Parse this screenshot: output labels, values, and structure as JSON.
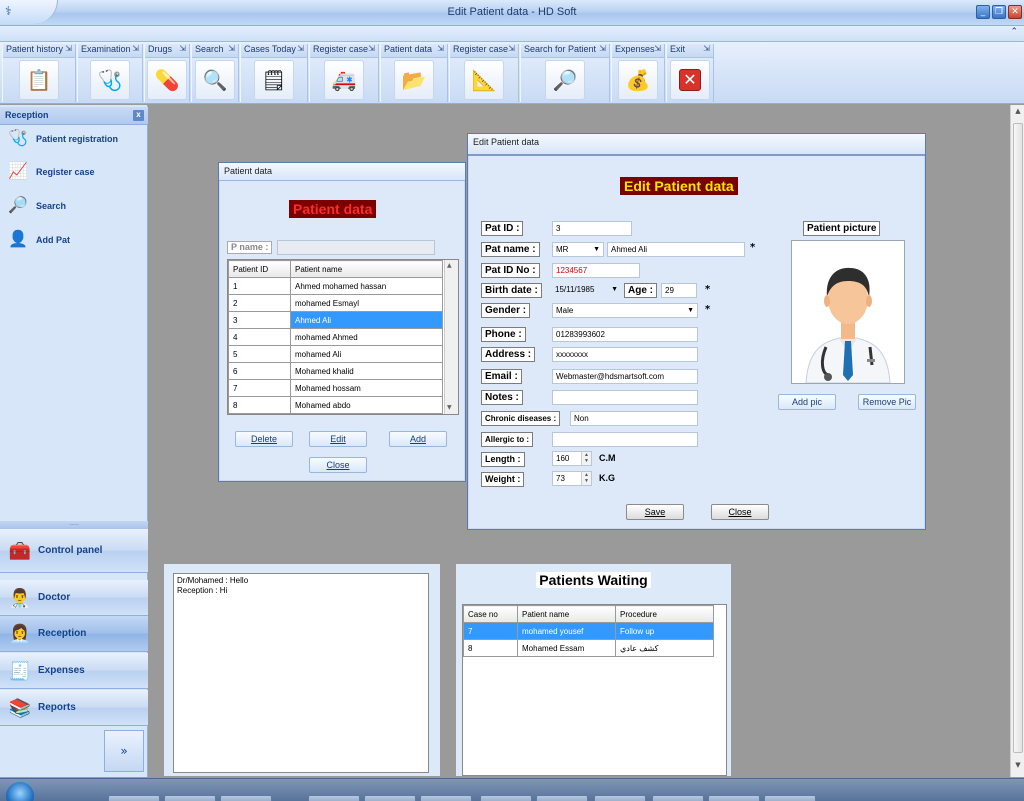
{
  "window": {
    "title": "Edit Patient data - HD Soft"
  },
  "toolbar": {
    "groups": [
      {
        "label": "Patient history",
        "icon": "patient-history-icon"
      },
      {
        "label": "Examination",
        "icon": "stethoscope-icon"
      },
      {
        "label": "Drugs",
        "icon": "pills-icon"
      },
      {
        "label": "Search",
        "icon": "magnifier-icon"
      },
      {
        "label": "Cases Today",
        "icon": "cases-icon"
      },
      {
        "label": "Register case",
        "icon": "register-case-icon"
      },
      {
        "label": "Patient  data",
        "icon": "folder-icon"
      },
      {
        "label": "Register case",
        "icon": "register-case-2-icon"
      },
      {
        "label": "Search for  Patient",
        "icon": "search-patient-icon"
      },
      {
        "label": "Expenses",
        "icon": "money-bag-icon"
      },
      {
        "label": "Exit",
        "icon": "exit-icon"
      }
    ]
  },
  "leftnav": {
    "header": "Reception",
    "items": [
      {
        "label": "Patient registration",
        "icon": "stethoscope-icon"
      },
      {
        "label": "Register case",
        "icon": "chart-icon"
      },
      {
        "label": "Search",
        "icon": "search-icon"
      },
      {
        "label": "Add Pat",
        "icon": "add-user-icon"
      }
    ],
    "bars": [
      {
        "label": "Control panel",
        "icon": "control-panel-icon"
      },
      {
        "label": "Doctor",
        "icon": "doctor-icon"
      },
      {
        "label": "Reception",
        "icon": "reception-icon"
      },
      {
        "label": "Expenses",
        "icon": "expenses-icon"
      },
      {
        "label": "Reports",
        "icon": "reports-icon"
      }
    ]
  },
  "patient_list": {
    "caption": "Patient  data",
    "title": "Patient  data",
    "pname_label": "P name :",
    "columns": [
      "Patient ID",
      "Patient  name"
    ],
    "rows": [
      [
        "1",
        "Ahmed mohamed hassan"
      ],
      [
        "2",
        "mohamed Esmayl"
      ],
      [
        "3",
        "Ahmed Ali"
      ],
      [
        "4",
        "mohamed Ahmed"
      ],
      [
        "5",
        "mohamed Ali"
      ],
      [
        "6",
        "Mohamed khalid"
      ],
      [
        "7",
        "Mohamed hossam"
      ],
      [
        "8",
        "Mohamed abdo"
      ]
    ],
    "selected_row": 2,
    "buttons": {
      "delete": "Delete",
      "edit": "Edit",
      "add": "Add",
      "close": "Close"
    }
  },
  "edit_form": {
    "caption": "Edit Patient data",
    "title": "Edit Patient data",
    "labels": {
      "pat_id": "Pat ID :",
      "pat_name": "Pat name :",
      "pat_id_no": "Pat ID No :",
      "birth_date": "Birth date :",
      "age": "Age :",
      "gender": "Gender :",
      "phone": "Phone :",
      "address": "Address :",
      "email": "Email :",
      "notes": "Notes :",
      "chronic": "Chronic diseases :",
      "allergic": "Allergic to :",
      "length": "Length :",
      "weight": "Weight :",
      "picture": "Patient  picture"
    },
    "values": {
      "pat_id": "3",
      "title_prefix": "MR",
      "pat_name": "Ahmed Ali",
      "pat_id_no": "1234567",
      "birth_date": "15/11/1985",
      "age": "29",
      "gender": "Male",
      "phone": "01283993602",
      "address": "xxxxxxxx",
      "email": "Webmaster@hdsmartsoft.com",
      "notes": "",
      "chronic": "Non",
      "allergic": "",
      "length": "160",
      "weight": "73"
    },
    "units": {
      "length": "C.M",
      "weight": "K.G"
    },
    "required_mark": "*",
    "buttons": {
      "add_pic": "Add pic",
      "remove_pic": "Remove Pic",
      "save": "Save",
      "close": "Close"
    },
    "colors": {
      "id_no_text": "#e00000",
      "title_fg": "#ffe600",
      "title_bg": "#7b0000"
    }
  },
  "chat": {
    "lines": [
      "Dr/Mohamed : Hello",
      "Reception : Hi"
    ]
  },
  "waiting": {
    "title": "Patients Waiting",
    "columns": [
      "Case no",
      "Patient name",
      "Procedure"
    ],
    "rows": [
      [
        "7",
        "mohamed yousef",
        "Follow up"
      ],
      [
        "8",
        "Mohamed Essam",
        "كشف عادي"
      ]
    ],
    "selected_row": 0
  }
}
